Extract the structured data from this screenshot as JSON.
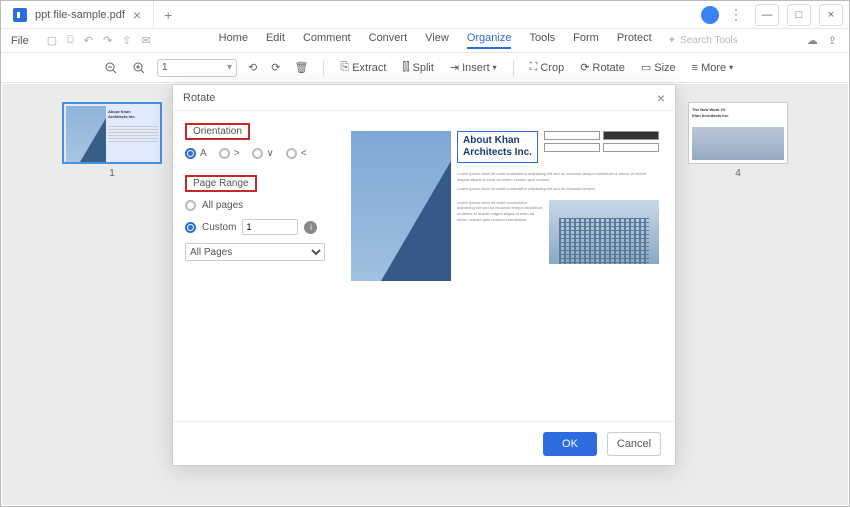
{
  "titlebar": {
    "filename": "ppt file-sample.pdf"
  },
  "menubar": {
    "file": "File",
    "items": [
      "Home",
      "Edit",
      "Comment",
      "Convert",
      "View",
      "Organize",
      "Tools",
      "Form",
      "Protect"
    ],
    "active_index": 5,
    "search_placeholder": "Search Tools"
  },
  "toolbar": {
    "page_current": "1",
    "extract": "Extract",
    "split": "Split",
    "insert": "Insert",
    "crop": "Crop",
    "rotate": "Rotate",
    "size": "Size",
    "more": "More"
  },
  "thumbnails": {
    "page1_num": "1",
    "page4_num": "4",
    "title_text": "About Khan\nArchitects Inc.",
    "title4a": "The New Work Of",
    "title4b": "Klan Architects Inc."
  },
  "dialog": {
    "title": "Rotate",
    "orientation_label": "Orientation",
    "orient_a": "A",
    "orient_right": ">",
    "orient_down": "∨",
    "orient_left": "<",
    "page_range_label": "Page Range",
    "all_pages": "All pages",
    "custom": "Custom",
    "custom_value": "1",
    "scope": "All Pages",
    "ok": "OK",
    "cancel": "Cancel",
    "preview_title": "About Khan\nArchitects Inc."
  }
}
